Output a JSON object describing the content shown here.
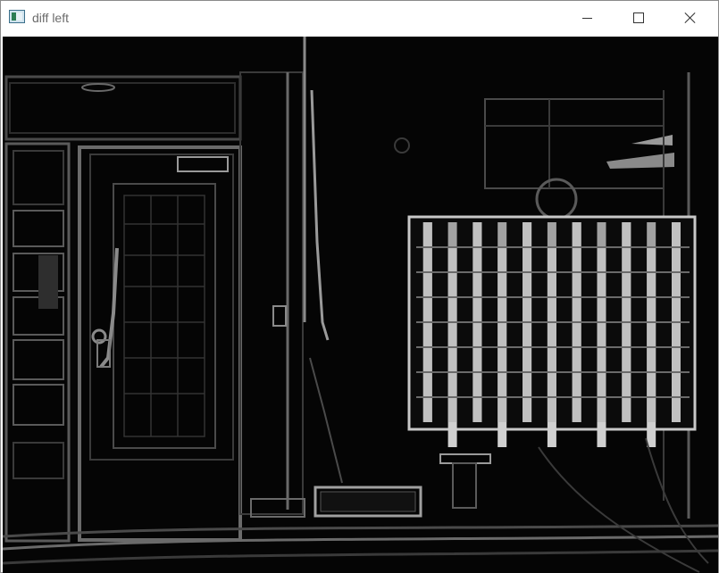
{
  "window": {
    "title": "diff left",
    "icon": "opencv-window-icon"
  },
  "controls": {
    "minimize": "minimize-icon",
    "maximize": "maximize-icon",
    "close": "close-icon"
  },
  "image": {
    "description_hidden": "",
    "colors": {
      "background": "#050505",
      "edge_dim": "#2a2a2a",
      "edge_mid": "#5a5a5a",
      "edge_bright": "#bdbdbd",
      "checker_light": "#d0d0d0"
    }
  }
}
